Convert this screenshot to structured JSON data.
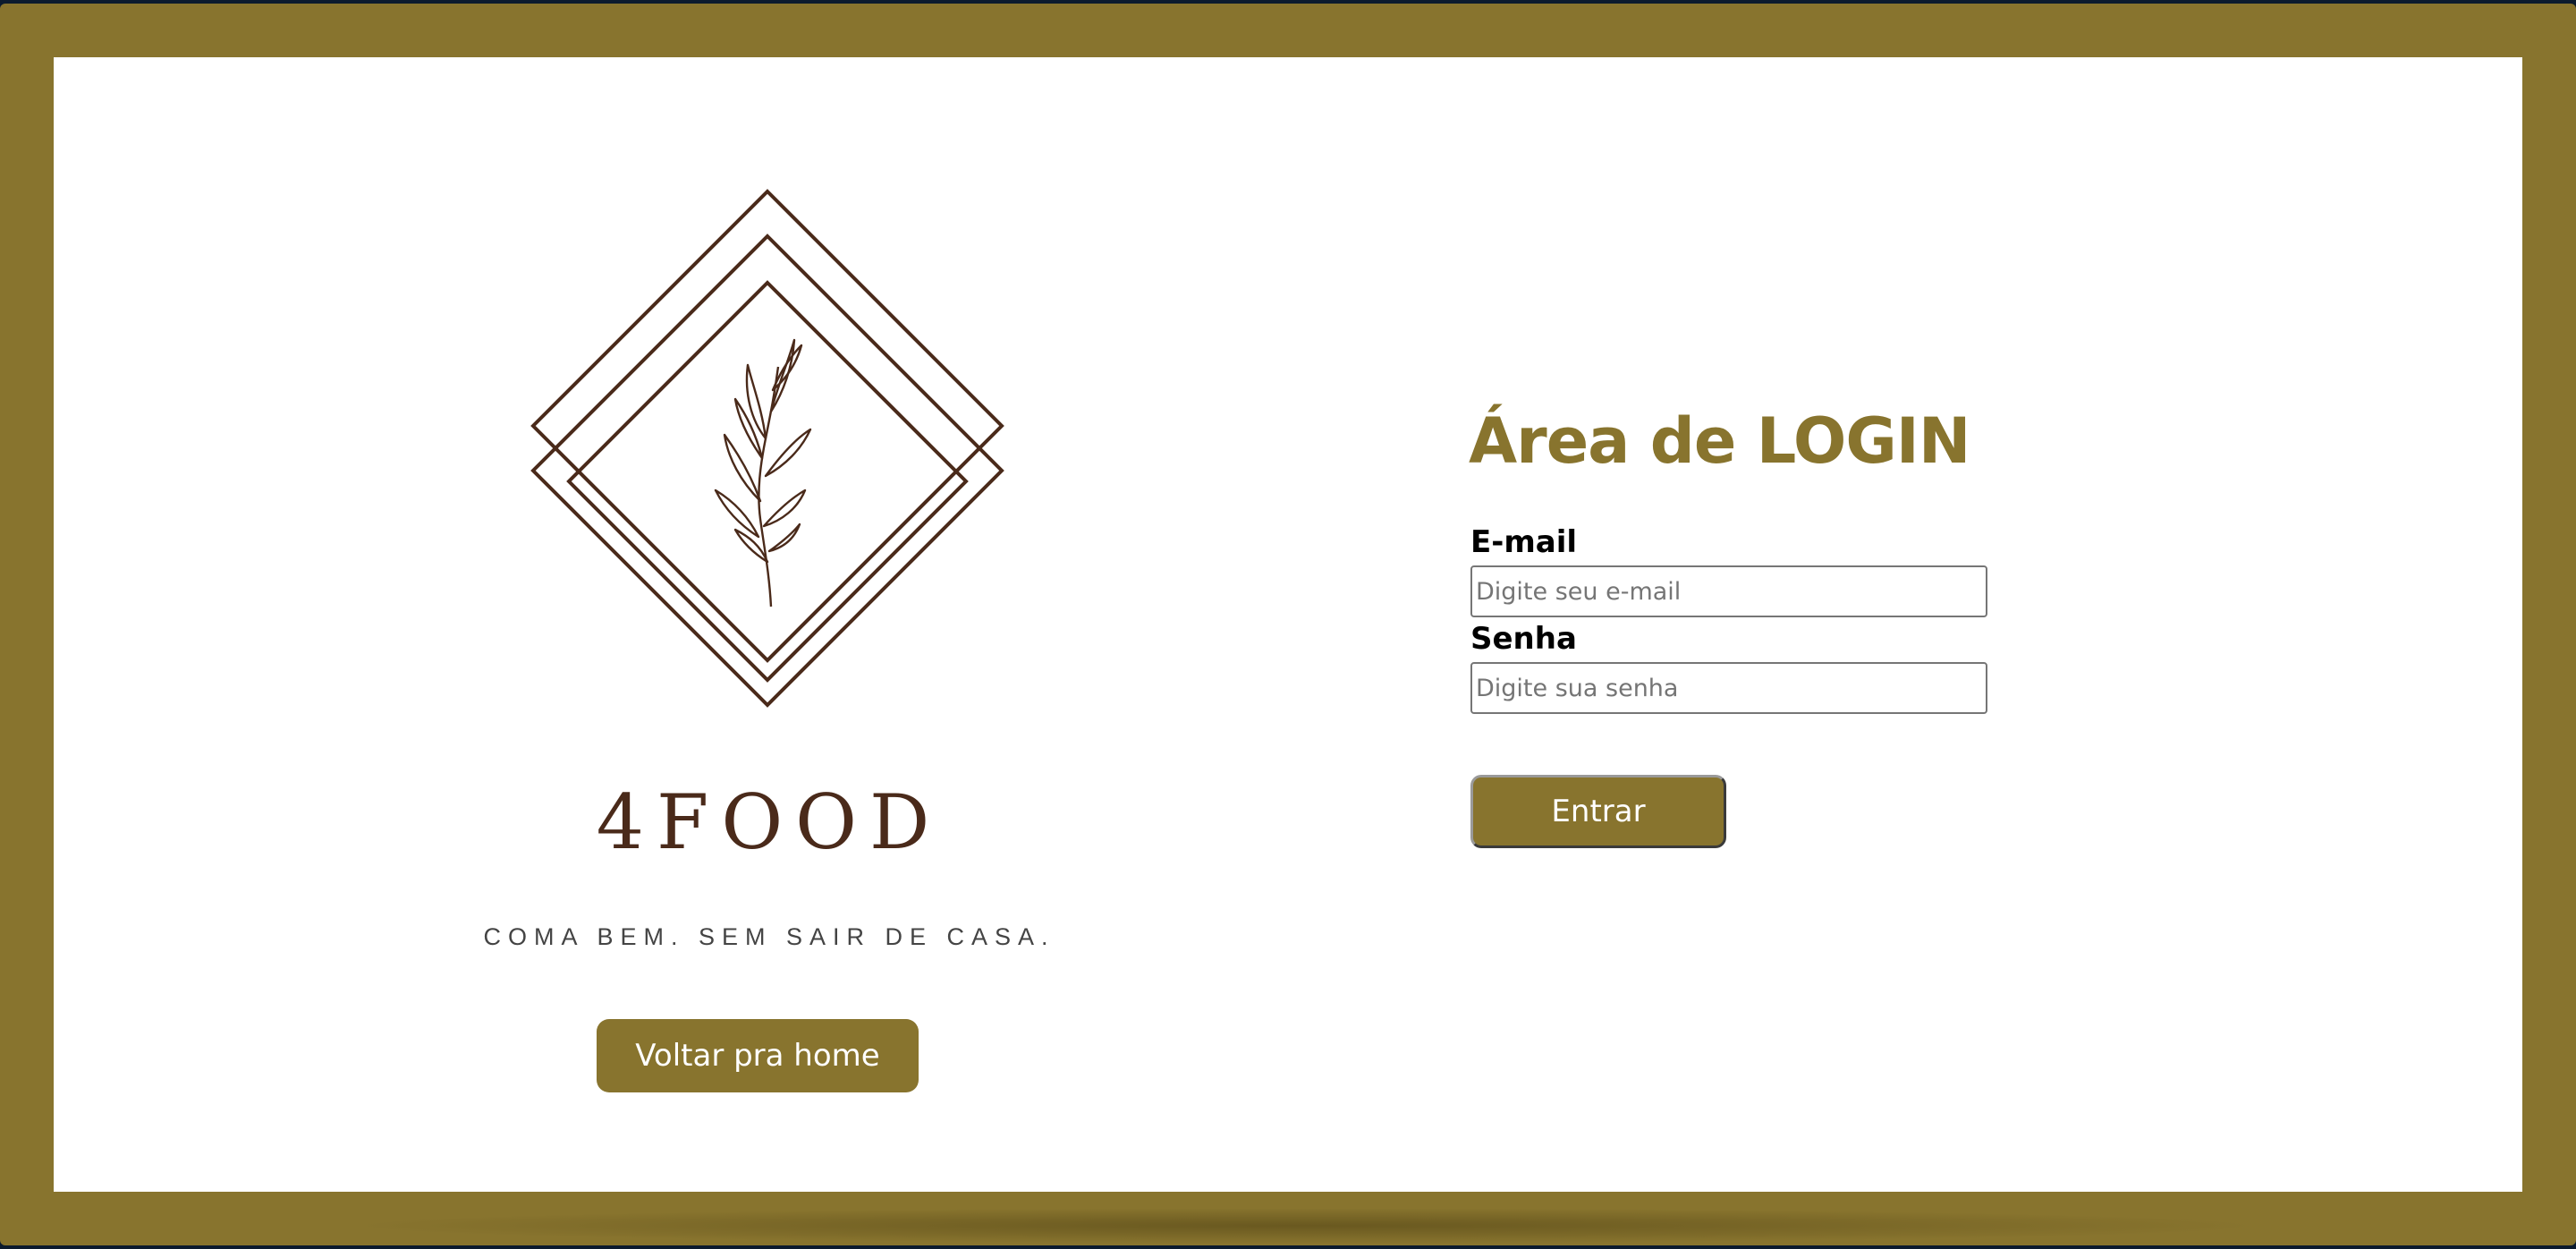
{
  "brand": {
    "name": "4FOOD",
    "tagline": "COMA BEM. SEM SAIR DE CASA.",
    "logo_icon": "leaf-diamond-logo-icon"
  },
  "nav": {
    "home_label": "Voltar pra home"
  },
  "login": {
    "title": "Área de LOGIN",
    "email_label": "E-mail",
    "email_placeholder": "Digite seu e-mail",
    "email_value": "",
    "password_label": "Senha",
    "password_placeholder": "Digite sua senha",
    "password_value": "",
    "submit_label": "Entrar"
  },
  "colors": {
    "accent": "#88742e",
    "logo_brown": "#4a2a1a",
    "background": "#ffffff"
  }
}
